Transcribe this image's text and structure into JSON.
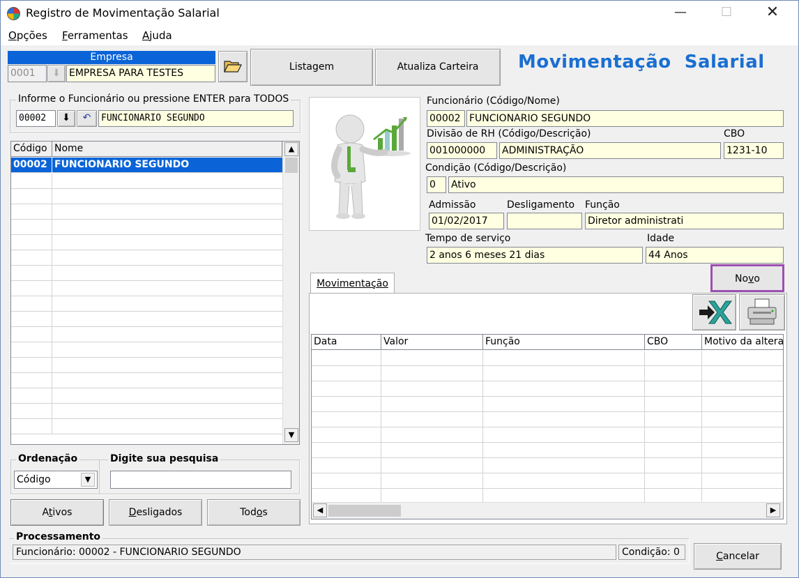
{
  "window": {
    "title": "Registro de Movimentação Salarial",
    "min_glyph": "—",
    "max_glyph": "☐",
    "close_glyph": "✕"
  },
  "menu": {
    "items": [
      {
        "label": "Opções"
      },
      {
        "label": "Ferramentas"
      },
      {
        "label": "Ajuda"
      }
    ]
  },
  "empresa": {
    "header": "Empresa",
    "code": "0001",
    "name": "EMPRESA PARA TESTES",
    "download_glyph": "⬇",
    "folder_icon": "open-folder-icon"
  },
  "toolbar": {
    "listagem_label": "Listagem",
    "atualiza_label": "Atualiza Carteira"
  },
  "heading": "Movimentação  Salarial",
  "search_group": {
    "legend": "Informe o Funcionário ou pressione ENTER para TODOS",
    "code": "00002",
    "name": "FUNCIONARIO SEGUNDO",
    "down_glyph": "⬇",
    "undo_glyph": "↶"
  },
  "employee_grid": {
    "columns": [
      "Código",
      "Nome"
    ],
    "rows": [
      {
        "code": "00002",
        "name": "FUNCIONARIO SEGUNDO"
      }
    ]
  },
  "ordenacao": {
    "legend": "Ordenação",
    "value": "Código"
  },
  "pesquisa": {
    "legend": "Digite sua pesquisa",
    "value": ""
  },
  "filter_buttons": {
    "ativos": "Ativos",
    "desligados": "Desligados",
    "todos": "Todos"
  },
  "details": {
    "funcionario_label": "Funcionário (Código/Nome)",
    "funcionario_code": "00002",
    "funcionario_name": "FUNCIONARIO SEGUNDO",
    "divisao_label": "Divisão de RH (Código/Descrição)",
    "divisao_code": "001000000",
    "divisao_desc": "ADMINISTRAÇÃO",
    "cbo_label": "CBO",
    "cbo_value": "1231-10",
    "condicao_label": "Condição (Código/Descrição)",
    "condicao_code": "0",
    "condicao_desc": "Ativo",
    "admissao_label": "Admissão",
    "admissao_value": "01/02/2017",
    "desligamento_label": "Desligamento",
    "desligamento_value": "",
    "funcao_label": "Função",
    "funcao_value": "Diretor administrati",
    "tempo_label": "Tempo de serviço",
    "tempo_value": "2 anos 6 meses 21 dias",
    "idade_label": "Idade",
    "idade_value": "44 Anos"
  },
  "tabs": [
    {
      "label": "Movimentação"
    }
  ],
  "novo_label": "Novo",
  "export_icons": [
    "excel-export-icon",
    "printer-icon"
  ],
  "movimentacao_grid": {
    "columns": [
      "Data",
      "Valor",
      "Função",
      "CBO",
      "Motivo da altera"
    ]
  },
  "processamento": {
    "legend": "Processamento",
    "status": "Funcionário: 00002 - FUNCIONARIO SEGUNDO",
    "condicao": "Condição: 0"
  },
  "cancel_label": "Cancelar",
  "colors": {
    "accent": "#1a6fd1",
    "selection": "#0a64d8",
    "field_bg": "#ffffe1",
    "highlight": "#9b4fb0"
  }
}
